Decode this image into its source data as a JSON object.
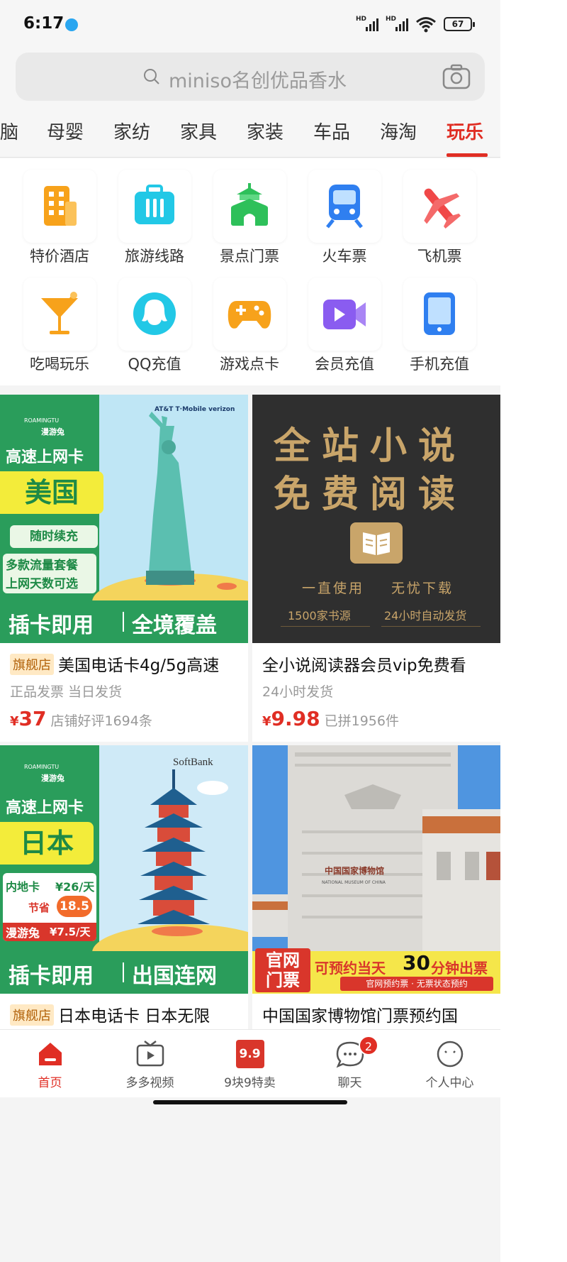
{
  "status": {
    "time": "6:17",
    "signal1": "HD",
    "signal2": "HD",
    "battery": "67"
  },
  "search": {
    "placeholder": "miniso名创优品香水",
    "icon": "search-icon",
    "camera_icon": "camera-icon"
  },
  "tabs": [
    {
      "label": "脑"
    },
    {
      "label": "母婴"
    },
    {
      "label": "家纺"
    },
    {
      "label": "家具"
    },
    {
      "label": "家装"
    },
    {
      "label": "车品"
    },
    {
      "label": "海淘"
    },
    {
      "label": "玩乐",
      "active": true
    }
  ],
  "services": [
    {
      "label": "特价酒店",
      "icon": "hotel-icon",
      "color": "#f7a21b"
    },
    {
      "label": "旅游线路",
      "icon": "suitcase-icon",
      "color": "#22c8e6"
    },
    {
      "label": "景点门票",
      "icon": "temple-icon",
      "color": "#2ec05a"
    },
    {
      "label": "火车票",
      "icon": "train-icon",
      "color": "#2f7ff0"
    },
    {
      "label": "飞机票",
      "icon": "airplane-icon",
      "color": "#f04848"
    },
    {
      "label": "吃喝玩乐",
      "icon": "cocktail-icon",
      "color": "#f7a21b"
    },
    {
      "label": "QQ充值",
      "icon": "qq-icon",
      "color": "#22c8e6"
    },
    {
      "label": "游戏点卡",
      "icon": "gamepad-icon",
      "color": "#f7a21b"
    },
    {
      "label": "会员充值",
      "icon": "video-icon",
      "color": "#8a5cf0"
    },
    {
      "label": "手机充值",
      "icon": "phone-icon",
      "color": "#2f7ff0"
    }
  ],
  "products": [
    {
      "badge": "旗舰店",
      "title": "美国电话卡4g/5g高速",
      "sub": "正品发票  当日发货",
      "price_yen": "¥",
      "price": "37",
      "meta": "店铺好评1694条",
      "banner": {
        "brand": "ROAMINGTU",
        "brand_cn": "漫游兔",
        "carriers": "AT&T  T·Mobile  verizon",
        "line1": "高速上网卡",
        "country": "美国",
        "line2": "随时续充",
        "line3a": "多款流量套餐",
        "line3b": "上网天数可选",
        "bottom_left": "插卡即用",
        "bottom_right": "全境覆盖"
      }
    },
    {
      "title": "全小说阅读器会员vip免费看",
      "sub": "24小时发货",
      "price_yen": "¥",
      "price": "9.98",
      "meta": "已拼1956件",
      "banner": {
        "line1": "全站小说",
        "line2": "免费阅读",
        "tag1": "一直使用",
        "tag2": "无忧下载",
        "foot1": "1500家书源",
        "foot2": "24小时自动发货"
      }
    },
    {
      "badge": "旗舰店",
      "title": "日本电话卡 日本无限",
      "banner": {
        "brand": "ROAMINGTU",
        "brand_cn": "漫游兔",
        "carrier": "SoftBank",
        "line1": "高速上网卡",
        "country": "日本",
        "inland": "内地卡",
        "inland_price": "¥26/天",
        "save": "节省",
        "save_val": "18.5",
        "ours": "漫游兔",
        "ours_price": "¥7.5/天",
        "bottom_left": "插卡即用",
        "bottom_right": "出国连网"
      }
    },
    {
      "title": "中国国家博物馆门票预约国",
      "banner": {
        "sign_cn": "中国国家博物馆",
        "sign_en": "NATIONAL MUSEUM OF CHINA",
        "tag": "官网门票",
        "promo_a": "可预约当天",
        "promo_b": "30",
        "promo_c": "分钟出票",
        "promo_sub": "官网预约票 · 无票状态预约"
      }
    }
  ],
  "nav": [
    {
      "label": "首页",
      "icon": "home-icon",
      "active": true
    },
    {
      "label": "多多视频",
      "icon": "tv-icon"
    },
    {
      "label": "9块9特卖",
      "icon": "sale-icon",
      "icon_text": "9.9"
    },
    {
      "label": "聊天",
      "icon": "chat-icon",
      "badge": "2"
    },
    {
      "label": "个人中心",
      "icon": "profile-icon"
    }
  ],
  "colors": {
    "accent": "#e02e24"
  }
}
